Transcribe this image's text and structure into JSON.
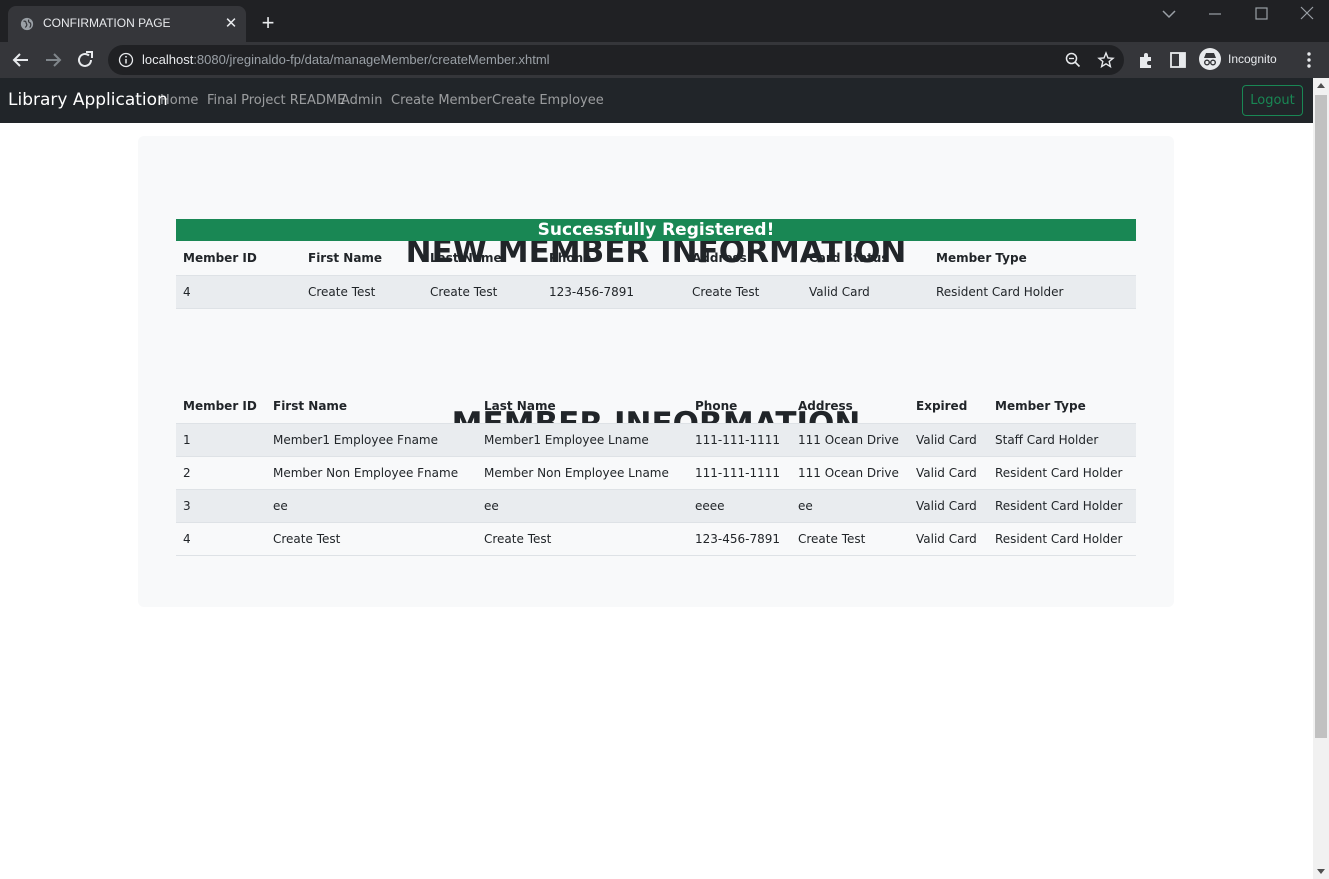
{
  "browser": {
    "tab_title": "CONFIRMATION PAGE",
    "url_host": "localhost",
    "url_rest": ":8080/jreginaldo-fp/data/manageMember/createMember.xhtml",
    "profile_label": "Incognito"
  },
  "navbar": {
    "brand": "Library Application",
    "links": [
      "Home",
      "Final Project README",
      "Admin",
      "Create Member",
      "Create Employee"
    ],
    "logout": "Logout"
  },
  "new_member": {
    "title": "NEW MEMBER INFORMATION",
    "status": "Successfully Registered!",
    "headers": [
      "Member ID",
      "First Name",
      "Last Name",
      "Phone",
      "Address",
      "Card Status",
      "Member Type"
    ],
    "rows": [
      [
        "4",
        "Create Test",
        "Create Test",
        "123-456-7891",
        "Create Test",
        "Valid Card",
        "Resident Card Holder"
      ]
    ]
  },
  "members": {
    "title": "MEMBER INFORMATION",
    "headers": [
      "Member ID",
      "First Name",
      "Last Name",
      "Phone",
      "Address",
      "Expired",
      "Member Type"
    ],
    "rows": [
      [
        "1",
        "Member1 Employee Fname",
        "Member1 Employee Lname",
        "111-111-1111",
        "111 Ocean Drive",
        "Valid Card",
        "Staff Card Holder"
      ],
      [
        "2",
        "Member Non Employee Fname",
        "Member Non Employee Lname",
        "111-111-1111",
        "111 Ocean Drive",
        "Valid Card",
        "Resident Card Holder"
      ],
      [
        "3",
        "ee",
        "ee",
        "eeee",
        "ee",
        "Valid Card",
        "Resident Card Holder"
      ],
      [
        "4",
        "Create Test",
        "Create Test",
        "123-456-7891",
        "Create Test",
        "Valid Card",
        "Resident Card Holder"
      ]
    ]
  }
}
